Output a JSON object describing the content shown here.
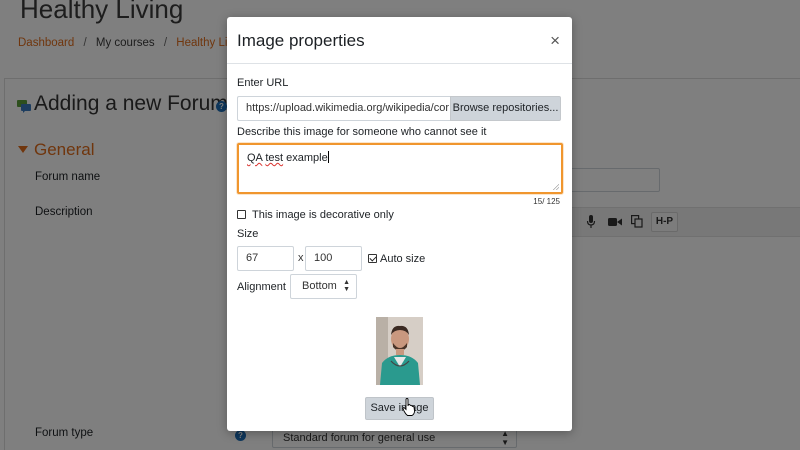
{
  "background_page": {
    "course_title": "Healthy Living",
    "breadcrumb": {
      "item_dashboard": "Dashboard",
      "item_my_courses": "My courses",
      "item_course": "Healthy Living",
      "separator": "/"
    },
    "heading": "Adding a new Forum",
    "section_title": "General",
    "labels": {
      "forum_name": "Forum name",
      "description": "Description",
      "forum_type": "Forum type"
    },
    "toolbar_hp_label": "H-P",
    "forum_type_value": "Standard forum for general use"
  },
  "modal": {
    "title": "Image properties",
    "close_glyph": "×",
    "url_label": "Enter URL",
    "url_value": "https://upload.wikimedia.org/wikipedia/cor",
    "browse_button": "Browse repositories...",
    "alt_label": "Describe this image for someone who cannot see it",
    "alt_word1": "QA",
    "alt_word2": "test",
    "alt_word3": "example",
    "char_count": "15/ 125",
    "decorative_label": "This image is decorative only",
    "decorative_checked": false,
    "size_label": "Size",
    "width_value": "67",
    "size_separator": "x",
    "height_value": "100",
    "auto_size_label": "Auto size",
    "auto_size_checked": true,
    "alignment_label": "Alignment",
    "alignment_value": "Bottom",
    "save_button": "Save image"
  },
  "colors": {
    "accent_orange": "#e06c1b",
    "focus_border": "#f0962e",
    "help_icon_blue": "#1e6fb8",
    "button_gray": "#ced4da"
  }
}
